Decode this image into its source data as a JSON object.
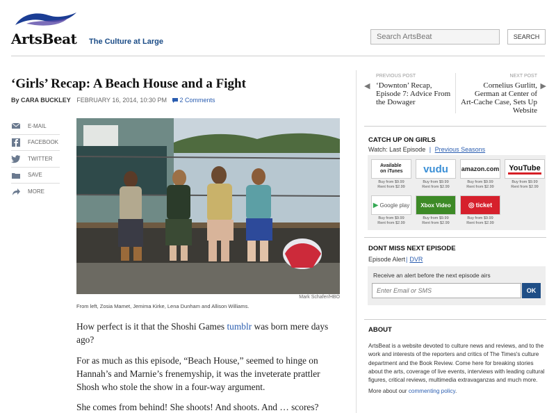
{
  "header": {
    "logo_text": "ArtsBeat",
    "tagline": "The Culture at Large",
    "search_placeholder": "Search ArtsBeat",
    "search_button": "SEARCH"
  },
  "article": {
    "title": "‘Girls’ Recap: A Beach House and a Fight",
    "byline_prefix": "By",
    "author": "CARA BUCKLEY",
    "date": "FEBRUARY 16, 2014, 10:30 PM",
    "comments": "2 Comments",
    "photo_credit": "Mark Schafer/HBO",
    "caption": "From left, Zosia Mamet, Jemima Kirke, Lena Dunham and Allison Williams.",
    "p1_before": "How perfect is it that the Shoshi Games ",
    "p1_link": "tumblr",
    "p1_after": " was born mere days ago?",
    "p2": "For as much as this episode, “Beach House,” seemed to hinge on Hannah’s and Marnie’s frenemyship, it was the inveterate prattler Shosh who stole the show in a four-way argument.",
    "p3": "She comes from behind! She shoots! And shoots. And … scores?"
  },
  "share": {
    "items": [
      {
        "label": "E-MAIL",
        "icon": "email-icon"
      },
      {
        "label": "FACEBOOK",
        "icon": "facebook-icon"
      },
      {
        "label": "TWITTER",
        "icon": "twitter-icon"
      },
      {
        "label": "SAVE",
        "icon": "save-icon"
      },
      {
        "label": "MORE",
        "icon": "more-icon"
      }
    ]
  },
  "sidebar": {
    "prev_label": "PREVIOUS POST",
    "prev_title_l1": "‘Downton’ Recap,",
    "prev_title_l2": "Episode 7: Advice From",
    "prev_title_l3": "the Dowager",
    "next_label": "NEXT POST",
    "next_title_l1": "Cornelius Gurlitt,",
    "next_title_l2": "German at Center of",
    "next_title_l3": "Art-Cache Case, Sets Up",
    "next_title_l4": "Website",
    "catchup_heading": "CATCH UP ON GIRLS",
    "watch_label": "Watch: Last Episode",
    "watch_sep": "|",
    "previous_seasons": "Previous Seasons",
    "vendors": [
      {
        "name": "Available on iTunes",
        "buy": "Buy from $9.99",
        "rent": "Rent from $2.99"
      },
      {
        "name": "vudu",
        "buy": "Buy from $9.99",
        "rent": "Rent from $2.99"
      },
      {
        "name": "amazon.com",
        "buy": "Buy from $9.99",
        "rent": "Rent from $2.99"
      },
      {
        "name": "YouTube",
        "buy": "Buy from $9.99",
        "rent": "Rent from $2.99"
      },
      {
        "name": "Google play",
        "buy": "Buy from $9.99",
        "rent": "Rent from $2.99"
      },
      {
        "name": "Xbox Video",
        "buy": "Buy from $9.99",
        "rent": "Rent from $2.99"
      },
      {
        "name": "ticket",
        "buy": "Buy from $9.99",
        "rent": "Rent from $2.99"
      }
    ],
    "dont_miss_heading": "DONT MISS NEXT EPISODE",
    "episode_alert": "Episode Alert",
    "dvr": "DVR",
    "alert_text": "Receive an alert before the next episode airs",
    "email_placeholder": "Enter Email or SMS",
    "ok_button": "OK",
    "about_heading": "ABOUT",
    "about_text": "ArtsBeat is a website devoted to culture news and reviews, and to the work and interests of the reporters and critics of The Times's culture department and the Book Review. Come here for breaking stories about the arts, coverage of live events, interviews with leading cultural figures, critical reviews, multimedia extravaganzas and much more.",
    "policy_before": "More about our ",
    "policy_link": "commenting policy",
    "policy_after": "."
  },
  "colors": {
    "link_blue": "#2a5db0",
    "tagline_blue": "#1a4b86",
    "ok_button_bg": "#1f4e86"
  }
}
